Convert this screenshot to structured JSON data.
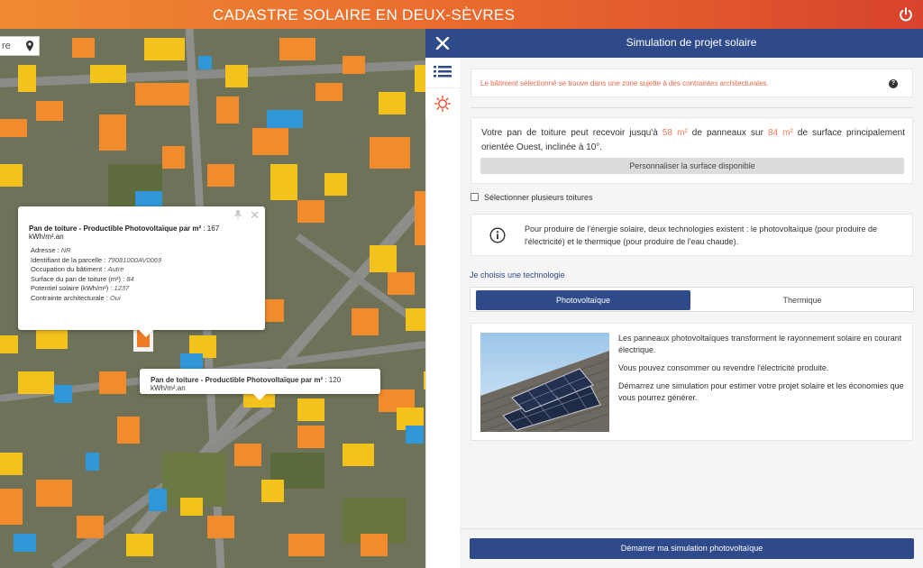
{
  "header": {
    "title": "CADASTRE SOLAIRE EN DEUX-SÈVRES",
    "accent_start": "#ef8a32",
    "accent_end": "#d8432c"
  },
  "map": {
    "search_partial_text": "re",
    "popup_main": {
      "title_bold": "Pan de toiture - Productible Photovoltaïque par m²",
      "title_value": " : 167 kWh/m².an",
      "rows": [
        {
          "label": "Adresse : ",
          "value": "NR"
        },
        {
          "label": "Identifiant de la parcelle : ",
          "value": "79081000AV0069"
        },
        {
          "label": "Occupation du bâtiment : ",
          "value": "Autre"
        },
        {
          "label": "Surface du pan de toiture (m²) : ",
          "value": "84"
        },
        {
          "label": "Potentiel solaire (kWh/m²) : ",
          "value": "1237"
        },
        {
          "label": "Contrainte architecturale : ",
          "value": "Oui"
        }
      ]
    },
    "popup_hover": {
      "title_bold": "Pan de toiture - Productible Photovoltaïque par m²",
      "title_value": " : 120 kWh/m².an"
    }
  },
  "panel": {
    "title": "Simulation de projet solaire",
    "warning": "Le bâtiment sélectionné se trouve dans une zone sujette à des contraintes architecturales.",
    "help": "?",
    "surface": {
      "part1": "Votre pan de toiture peut recevoir jusqu'à ",
      "panels_area": "58 m²",
      "part2": " de panneaux sur ",
      "roof_area": "84 m²",
      "part3": " de surface principalement orientée Ouest, inclinée à 10°.",
      "customize_button": "Personnaliser la surface disponible"
    },
    "multi_select_label": "Sélectionner plusieurs toitures",
    "info_text": "Pour produire de l'énergie solaire, deux technologies existent : le photovoltaïque (pour produire de l'électricité) et le thermique (pour produire de l'eau chaude).",
    "choose_label": "Je choisis une technologie",
    "tabs": {
      "photovoltaic": "Photovoltaïque",
      "thermal": "Thermique"
    },
    "pv_description": [
      "Les panneaux photovoltaïques transforment le rayonnement solaire en courant électrique.",
      "Vous pouvez consommer ou revendre l'électricité produite.",
      "Démarrez une simulation pour estimer votre projet solaire et les économies que vous pourrez générer."
    ],
    "start_button": "Démarrer ma simulation photovoltaïque",
    "primary_color": "#2e4a8b",
    "highlight_color": "#ef7b5d"
  }
}
